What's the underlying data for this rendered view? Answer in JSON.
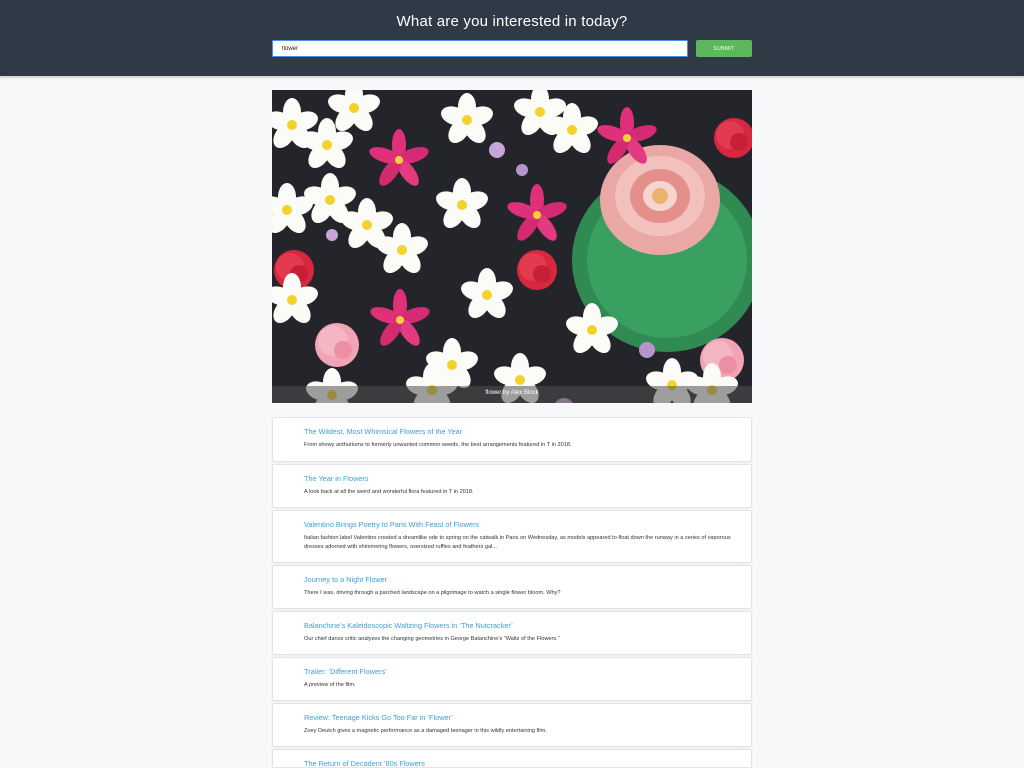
{
  "header": {
    "title": "What are you interested in today?",
    "search_value": "flower",
    "submit_label": "SUBMIT"
  },
  "hero": {
    "alt": "flower",
    "caption": "flower by Alex Block"
  },
  "results": [
    {
      "title": "The Wildest, Most Whimsical Flowers of the Year",
      "description": "From showy anthuriums to formerly unwanted common weeds, the best arrangements featured in T in 2018."
    },
    {
      "title": "The Year in Flowers",
      "description": "A look back at all the weird and wonderful flora featured in T in 2018."
    },
    {
      "title": "Valentino Brings Poetry to Paris With Feast of Flowers",
      "description": "Italian fashion label Valentino created a dreamlike ode to spring on the catwalk in Paris on Wednesday, as models appeared to float down the runway in a series of vaporous dresses adorned with shimmering flowers, oversized ruffles and feathers gal..."
    },
    {
      "title": "Journey to a Night Flower",
      "description": "There I was, driving through a parched landscape on a pilgrimage to watch a single flower bloom. Why?"
    },
    {
      "title": "Balanchine’s Kaleidoscopic Waltzing Flowers in ‘The Nutcracker’",
      "description": "Our chief dance critic analyzes the changing geometries in George Balanchine’s “Waltz of the Flowers.”"
    },
    {
      "title": "Trailer: ‘Different Flowers’",
      "description": "A preview of the film."
    },
    {
      "title": "Review: Teenage Kicks Go Too Far in ‘Flower’",
      "description": "Zoey Deutch gives a magnetic performance as a damaged teenager in this wildly entertaining film."
    },
    {
      "title": "The Return of Decadent ’80s Flowers",
      "description": ""
    }
  ],
  "colors": {
    "header_bg": "#2f3a46",
    "accent_link": "#3e9fd6",
    "submit_bg": "#5cb85c",
    "input_border": "#4a90e2"
  }
}
